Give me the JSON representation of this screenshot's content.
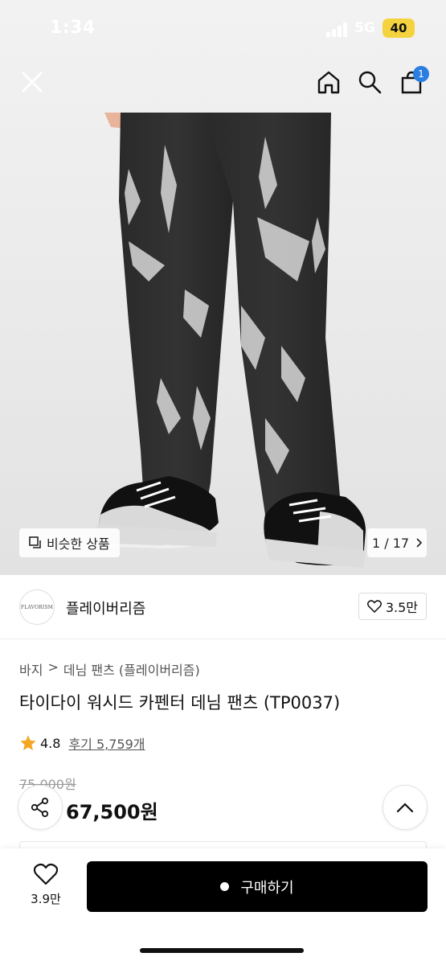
{
  "status_bar": {
    "time": "1:34",
    "network": "5G",
    "battery": "40"
  },
  "nav": {
    "cart_count": "1"
  },
  "gallery": {
    "similar_label": "비슷한 상품",
    "current": "1",
    "total": "17"
  },
  "brand": {
    "logo_text": "FLAVORISM",
    "name": "플레이버리즘",
    "likes": "3.5만"
  },
  "product": {
    "breadcrumb": [
      "바지",
      "데님 팬츠 (플레이버리즘)"
    ],
    "title": "타이다이 워시드 카펜터 데님 팬츠 (TP0037)",
    "rating": "4.8",
    "review_link": "후기 5,759개",
    "original_price": "75,000원",
    "sale_price": "67,500원"
  },
  "bottom_bar": {
    "wish_count": "3.9만",
    "buy_label": "구매하기"
  },
  "colors": {
    "accent_blue": "#2a7de1",
    "rating_star": "#f5a623",
    "buy_button": "#000000",
    "battery": "#f5d33f"
  }
}
